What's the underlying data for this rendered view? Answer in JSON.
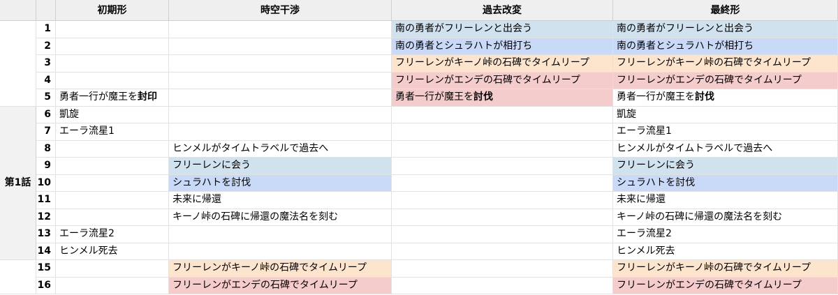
{
  "headers": [
    "初期形",
    "時空干渉",
    "過去改変",
    "最終形"
  ],
  "group_label": "第1話",
  "colors": {
    "blue": "#d0e2ee",
    "periwinkle": "#c9daf8",
    "peach": "#fde5cd",
    "pink": "#f4cccc"
  },
  "rows": [
    {
      "num": "1",
      "c1": "",
      "c2": "",
      "c3": "南の勇者がフリーレンと出会う",
      "c3_bold": "",
      "c3_color": "blue",
      "c4": "南の勇者がフリーレンと出会う",
      "c4_bold": "",
      "c4_color": "blue",
      "c2_color": ""
    },
    {
      "num": "2",
      "c1": "",
      "c2": "",
      "c3": "南の勇者とシュラハトが相打ち",
      "c3_bold": "",
      "c3_color": "periwinkle",
      "c4": "南の勇者とシュラハトが相打ち",
      "c4_bold": "",
      "c4_color": "periwinkle",
      "c2_color": ""
    },
    {
      "num": "3",
      "c1": "",
      "c2": "",
      "c3": "フリーレンがキーノ峠の石碑でタイムリープ",
      "c3_bold": "",
      "c3_color": "peach",
      "c4": "フリーレンがキーノ峠の石碑でタイムリープ",
      "c4_bold": "",
      "c4_color": "peach",
      "c2_color": ""
    },
    {
      "num": "4",
      "c1": "",
      "c2": "",
      "c3": "フリーレンがエンデの石碑でタイムリープ",
      "c3_bold": "",
      "c3_color": "pink",
      "c4": "フリーレンがエンデの石碑でタイムリープ",
      "c4_bold": "",
      "c4_color": "pink",
      "c2_color": ""
    },
    {
      "num": "5",
      "c1": "勇者一行が魔王を",
      "c1_bold": "封印",
      "c2": "",
      "c3": "勇者一行が魔王を",
      "c3_bold": "討伐",
      "c3_color": "pink",
      "c4": "勇者一行が魔王を",
      "c4_bold": "討伐",
      "c4_color": "",
      "c2_color": ""
    },
    {
      "num": "6",
      "c1": "凱旋",
      "c2": "",
      "c3": "",
      "c3_bold": "",
      "c3_color": "",
      "c4": "凱旋",
      "c4_bold": "",
      "c4_color": "",
      "c2_color": ""
    },
    {
      "num": "7",
      "c1": "エーラ流星1",
      "c2": "",
      "c3": "",
      "c3_bold": "",
      "c3_color": "",
      "c4": "エーラ流星1",
      "c4_bold": "",
      "c4_color": "",
      "c2_color": ""
    },
    {
      "num": "8",
      "c1": "",
      "c2": "ヒンメルがタイムトラベルで過去へ",
      "c3": "",
      "c3_bold": "",
      "c3_color": "",
      "c4": "ヒンメルがタイムトラベルで過去へ",
      "c4_bold": "",
      "c4_color": "",
      "c2_color": ""
    },
    {
      "num": "9",
      "c1": "",
      "c2": "フリーレンに会う",
      "c3": "",
      "c3_bold": "",
      "c3_color": "",
      "c4": "フリーレンに会う",
      "c4_bold": "",
      "c4_color": "blue",
      "c2_color": "blue"
    },
    {
      "num": "10",
      "c1": "",
      "c2": "シュラハトを討伐",
      "c3": "",
      "c3_bold": "",
      "c3_color": "",
      "c4": "シュラハトを討伐",
      "c4_bold": "",
      "c4_color": "periwinkle",
      "c2_color": "periwinkle"
    },
    {
      "num": "11",
      "c1": "",
      "c2": "未来に帰還",
      "c3": "",
      "c3_bold": "",
      "c3_color": "",
      "c4": "未来に帰還",
      "c4_bold": "",
      "c4_color": "",
      "c2_color": ""
    },
    {
      "num": "12",
      "c1": "",
      "c2": "キーノ峠の石碑に帰還の魔法名を刻む",
      "c3": "",
      "c3_bold": "",
      "c3_color": "",
      "c4": "キーノ峠の石碑に帰還の魔法名を刻む",
      "c4_bold": "",
      "c4_color": "",
      "c2_color": ""
    },
    {
      "num": "13",
      "c1": "エーラ流星2",
      "c2": "",
      "c3": "",
      "c3_bold": "",
      "c3_color": "",
      "c4": "エーラ流星2",
      "c4_bold": "",
      "c4_color": "",
      "c2_color": ""
    },
    {
      "num": "14",
      "c1": "ヒンメル死去",
      "c2": "",
      "c3": "",
      "c3_bold": "",
      "c3_color": "",
      "c4": "ヒンメル死去",
      "c4_bold": "",
      "c4_color": "",
      "c2_color": ""
    },
    {
      "num": "15",
      "c1": "",
      "c2": "フリーレンがキーノ峠の石碑でタイムリープ",
      "c3": "",
      "c3_bold": "",
      "c3_color": "",
      "c4": "フリーレンがキーノ峠の石碑でタイムリープ",
      "c4_bold": "",
      "c4_color": "peach",
      "c2_color": "peach"
    },
    {
      "num": "16",
      "c1": "",
      "c2": "フリーレンがエンデの石碑でタイムリープ",
      "c3": "",
      "c3_bold": "",
      "c3_color": "",
      "c4": "フリーレンがエンデの石碑でタイムリープ",
      "c4_bold": "",
      "c4_color": "pink",
      "c2_color": "pink"
    }
  ]
}
